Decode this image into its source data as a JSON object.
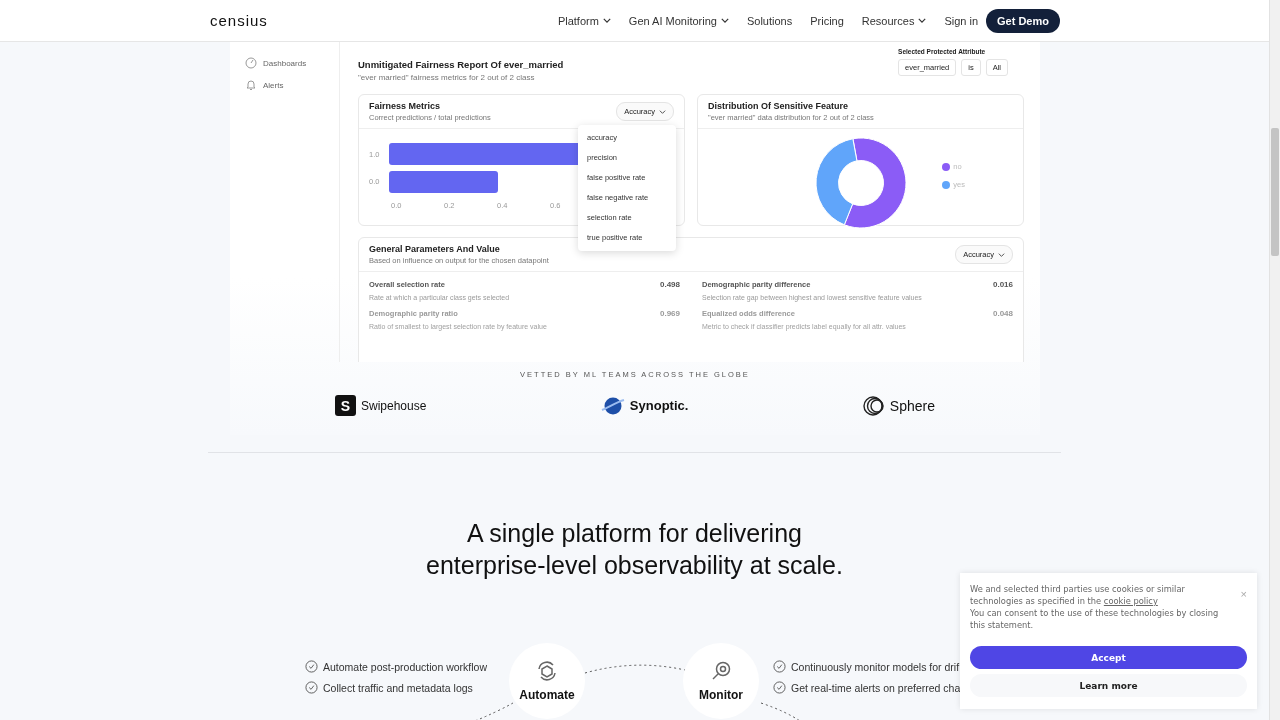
{
  "nav": {
    "logo": "censius",
    "items": [
      {
        "label": "Platform",
        "caret": true
      },
      {
        "label": "Gen AI Monitoring",
        "caret": true
      },
      {
        "label": "Solutions",
        "caret": false
      },
      {
        "label": "Pricing",
        "caret": false
      },
      {
        "label": "Resources",
        "caret": true
      }
    ],
    "sign_in": "Sign in",
    "cta": "Get Demo"
  },
  "sidebar": {
    "items": [
      {
        "label": "Dashboards"
      },
      {
        "label": "Alerts"
      }
    ]
  },
  "report": {
    "title": "Unmitigated Fairness Report Of ever_married",
    "subtitle": "\"ever married\" fairness metrics for 2 out of 2 class",
    "attribute_label": "Selected Protected Attribute",
    "filters": [
      "ever_married",
      "is",
      "All"
    ]
  },
  "fairness_card": {
    "title": "Fairness Metrics",
    "subtitle": "Correct predictions / total predictions",
    "dropdown": "Accuracy",
    "y_labels": [
      "1.0",
      "0.0"
    ],
    "x_ticks": [
      "0.0",
      "0.2",
      "0.4",
      "0.6"
    ]
  },
  "metric_menu": [
    "accuracy",
    "precision",
    "false positive rate",
    "false negative rate",
    "selection rate",
    "true positive rate"
  ],
  "distribution_card": {
    "title": "Distribution Of Sensitive Feature",
    "subtitle": "\"ever married\" data distribution for 2 out of 2 class",
    "legend": [
      {
        "label": "no",
        "color": "#8b5cf6"
      },
      {
        "label": "yes",
        "color": "#60a5fa"
      }
    ]
  },
  "params_card": {
    "title": "General Parameters And Value",
    "subtitle": "Based on influence on output for the chosen datapoint",
    "dropdown": "Accuracy",
    "params": [
      {
        "name": "Overall selection rate",
        "value": "0.498",
        "description": "Rate at which a particular class gets selected"
      },
      {
        "name": "Demographic parity difference",
        "value": "0.016",
        "description": "Selection rate gap between highest and lowest sensitive feature values"
      },
      {
        "name": "Demographic parity ratio",
        "value": "0.969",
        "description": "Ratio of smallest to largest selection rate by feature value"
      },
      {
        "name": "Equalized odds difference",
        "value": "0.048",
        "description": "Metric to check if classifier predicts label equally for all attr. values"
      }
    ]
  },
  "vetted": {
    "caption": "VETTED BY ML TEAMS ACROSS THE GLOBE",
    "logos": [
      {
        "kind": "square",
        "mark": "S",
        "name": "Swipehouse"
      },
      {
        "kind": "globe",
        "name": "Synoptic."
      },
      {
        "kind": "rings",
        "name": "Sphere"
      }
    ]
  },
  "headline_lines": [
    "A single platform for delivering",
    "enterprise-level observability at scale."
  ],
  "features": [
    {
      "kind": "automate",
      "label": "Automate",
      "bullets": [
        "Automate post-production workflow",
        "Collect traffic and metadata logs"
      ]
    },
    {
      "kind": "monitor",
      "label": "Monitor",
      "bullets": [
        "Continuously monitor models for drif",
        "Get real-time alerts on preferred cha"
      ]
    }
  ],
  "cookie": {
    "text_before": "We and selected third parties use cookies or similar technologies as specified in the",
    "link": "cookie policy",
    "text_after": "You can consent to the use of these technologies by closing this statement.",
    "close": "×",
    "accept": "Accept",
    "learn_more": "Learn more"
  }
}
